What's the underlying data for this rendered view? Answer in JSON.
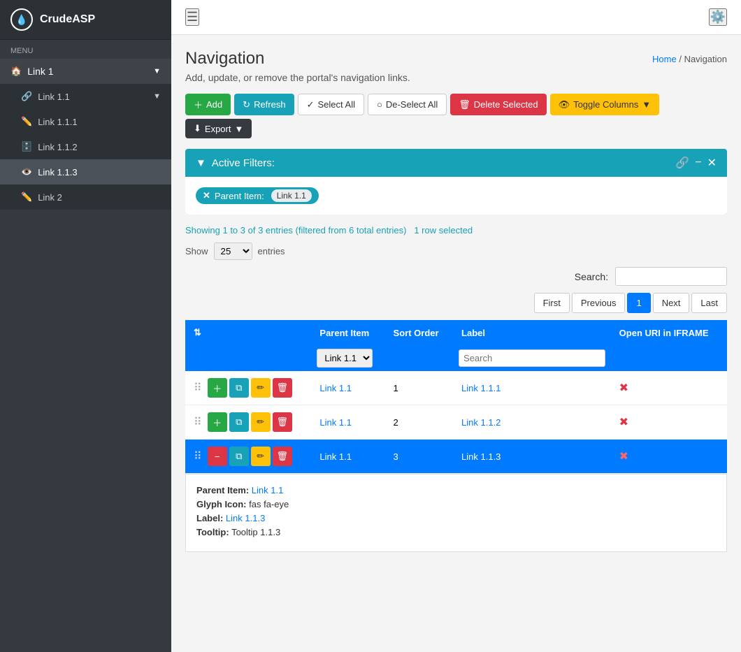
{
  "app": {
    "brand": "CrudeASP",
    "logo_char": "💧"
  },
  "sidebar": {
    "menu_label": "Menu",
    "items": [
      {
        "id": "link1",
        "label": "Link 1",
        "icon": "🏠",
        "level": 0,
        "has_children": true,
        "expanded": true
      },
      {
        "id": "link1-1",
        "label": "Link 1.1",
        "icon": "🔗",
        "level": 1,
        "has_children": true,
        "expanded": true
      },
      {
        "id": "link1-1-1",
        "label": "Link 1.1.1",
        "icon": "✏️",
        "level": 2,
        "has_children": false
      },
      {
        "id": "link1-1-2",
        "label": "Link 1.1.2",
        "icon": "🗄️",
        "level": 2,
        "has_children": false
      },
      {
        "id": "link1-1-3",
        "label": "Link 1.1.3",
        "icon": "👁️",
        "level": 2,
        "has_children": false,
        "active": true
      },
      {
        "id": "link2",
        "label": "Link 2",
        "icon": "✏️",
        "level": 0,
        "has_children": false
      }
    ]
  },
  "topbar": {
    "hamburger_title": "Toggle Sidebar"
  },
  "breadcrumb": {
    "home": "Home",
    "current": "Navigation"
  },
  "page": {
    "title": "Navigation",
    "description": "Add, update, or remove the portal's navigation links."
  },
  "toolbar": {
    "add_label": "Add",
    "refresh_label": "Refresh",
    "select_all_label": "Select All",
    "deselect_all_label": "De-Select All",
    "delete_selected_label": "Delete Selected",
    "toggle_columns_label": "Toggle Columns",
    "export_label": "Export"
  },
  "filters": {
    "title": "Active Filters:",
    "items": [
      {
        "key": "Parent Item",
        "value": "Link 1.1"
      }
    ]
  },
  "table_info": {
    "showing": "Showing 1 to 3 of 3 entries (filtered from 6 total entries)",
    "row_selected": "1 row selected",
    "show_label": "Show",
    "show_value": "25",
    "entries_label": "entries"
  },
  "search": {
    "label": "Search:",
    "placeholder": ""
  },
  "pagination": {
    "buttons": [
      "First",
      "Previous",
      "1",
      "Next",
      "Last"
    ],
    "active_index": 2
  },
  "table": {
    "headers": [
      "",
      "Parent Item",
      "Sort Order",
      "Label",
      "Open URI in IFRAME"
    ],
    "filter_row": {
      "parent_item_value": "Link 1.1",
      "parent_item_options": [
        "Link 1.1"
      ],
      "search_placeholder": "Search"
    },
    "rows": [
      {
        "id": 1,
        "parent_item": "Link 1.1",
        "sort_order": "1",
        "label": "Link 1.1.1",
        "open_uri": false,
        "selected": false
      },
      {
        "id": 2,
        "parent_item": "Link 1.1",
        "sort_order": "2",
        "label": "Link 1.1.2",
        "open_uri": false,
        "selected": false
      },
      {
        "id": 3,
        "parent_item": "Link 1.1",
        "sort_order": "3",
        "label": "Link 1.1.3",
        "open_uri": false,
        "selected": true
      }
    ]
  },
  "detail": {
    "parent_item_label": "Parent Item:",
    "parent_item_value": "Link 1.1",
    "glyph_icon_label": "Glyph Icon:",
    "glyph_icon_value": "fas fa-eye",
    "label_label": "Label:",
    "label_value": "Link 1.1.3",
    "tooltip_label": "Tooltip:",
    "tooltip_value": "Tooltip 1.1.3"
  }
}
